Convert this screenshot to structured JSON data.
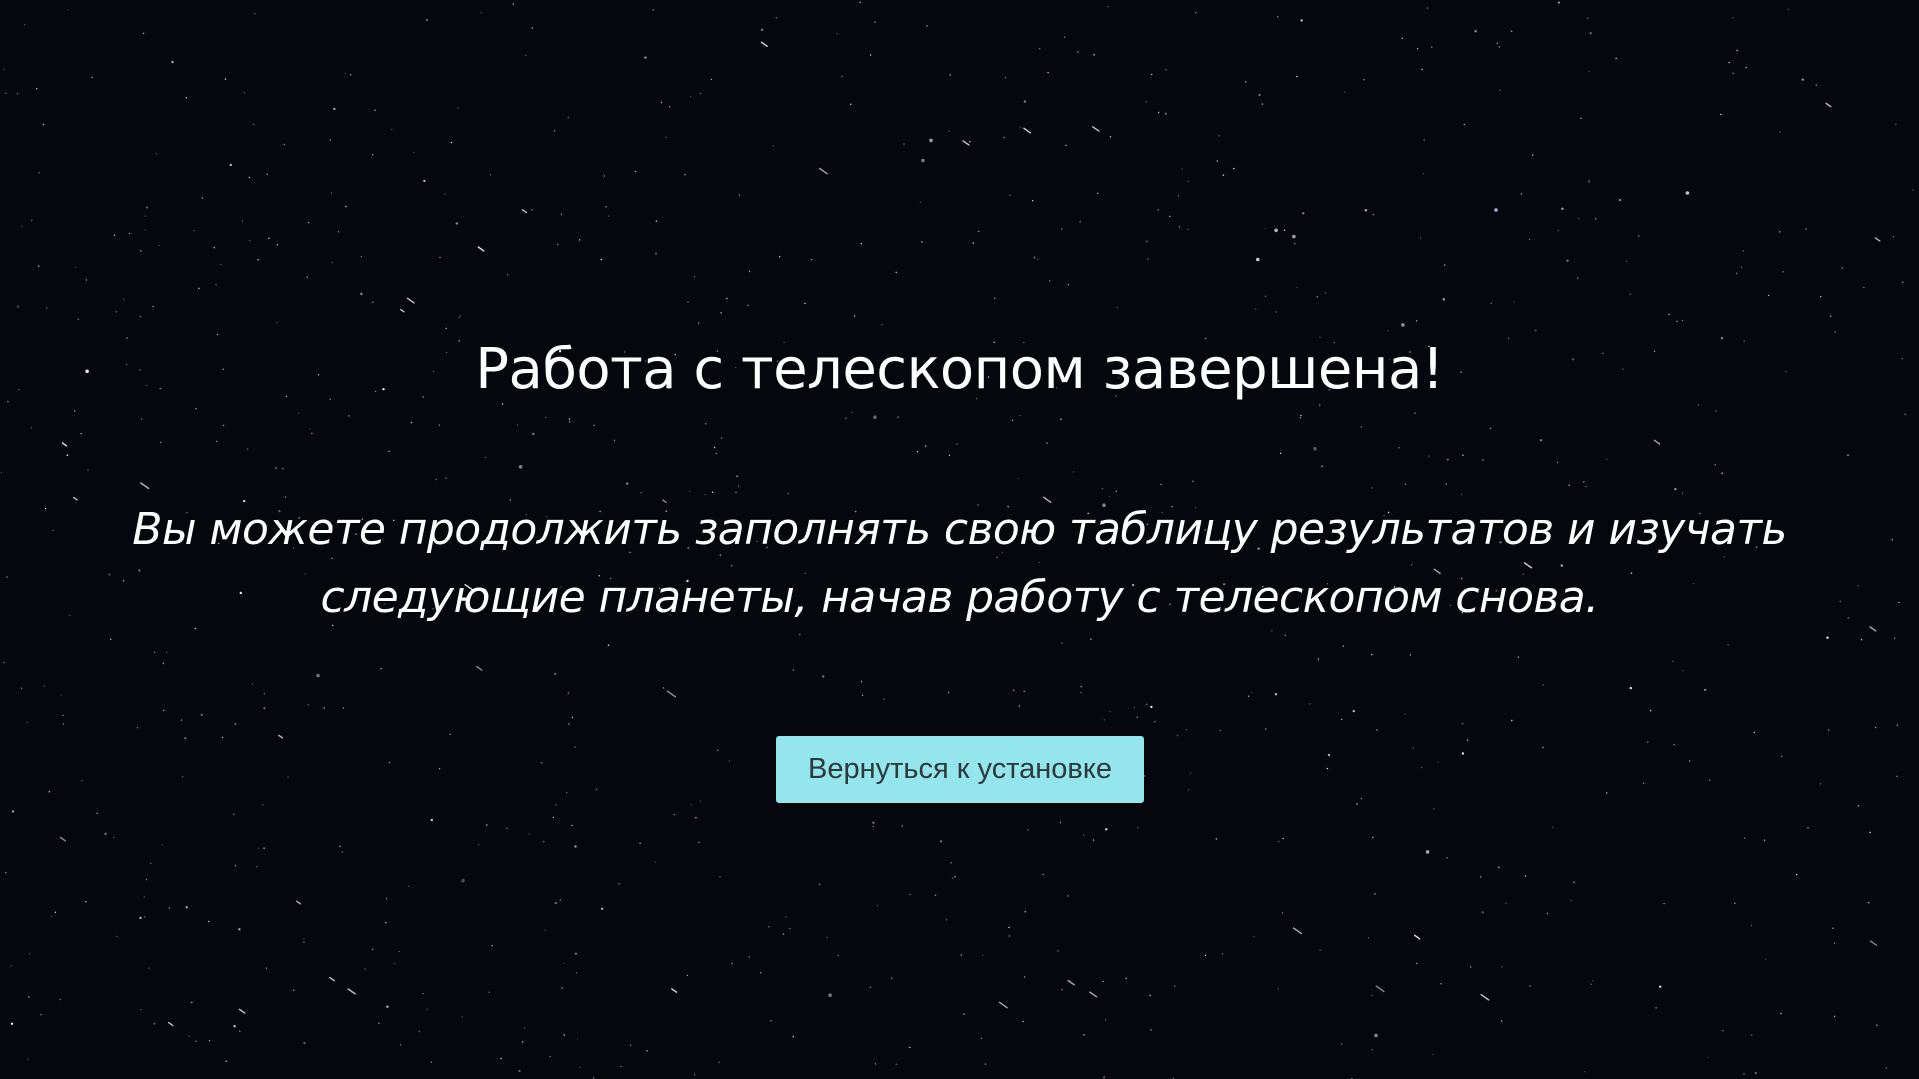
{
  "page": {
    "title": "Работа с телескопом завершена!",
    "message": "Вы можете продолжить заполнять свою таблицу результатов и изучать следующие планеты, начав работу с телескопом снова.",
    "return_button_label": "Вернуться к установке"
  },
  "colors": {
    "background": "#05070d",
    "text": "#ffffff",
    "button_background": "#95e5ec",
    "button_text": "#2b3a3c"
  }
}
